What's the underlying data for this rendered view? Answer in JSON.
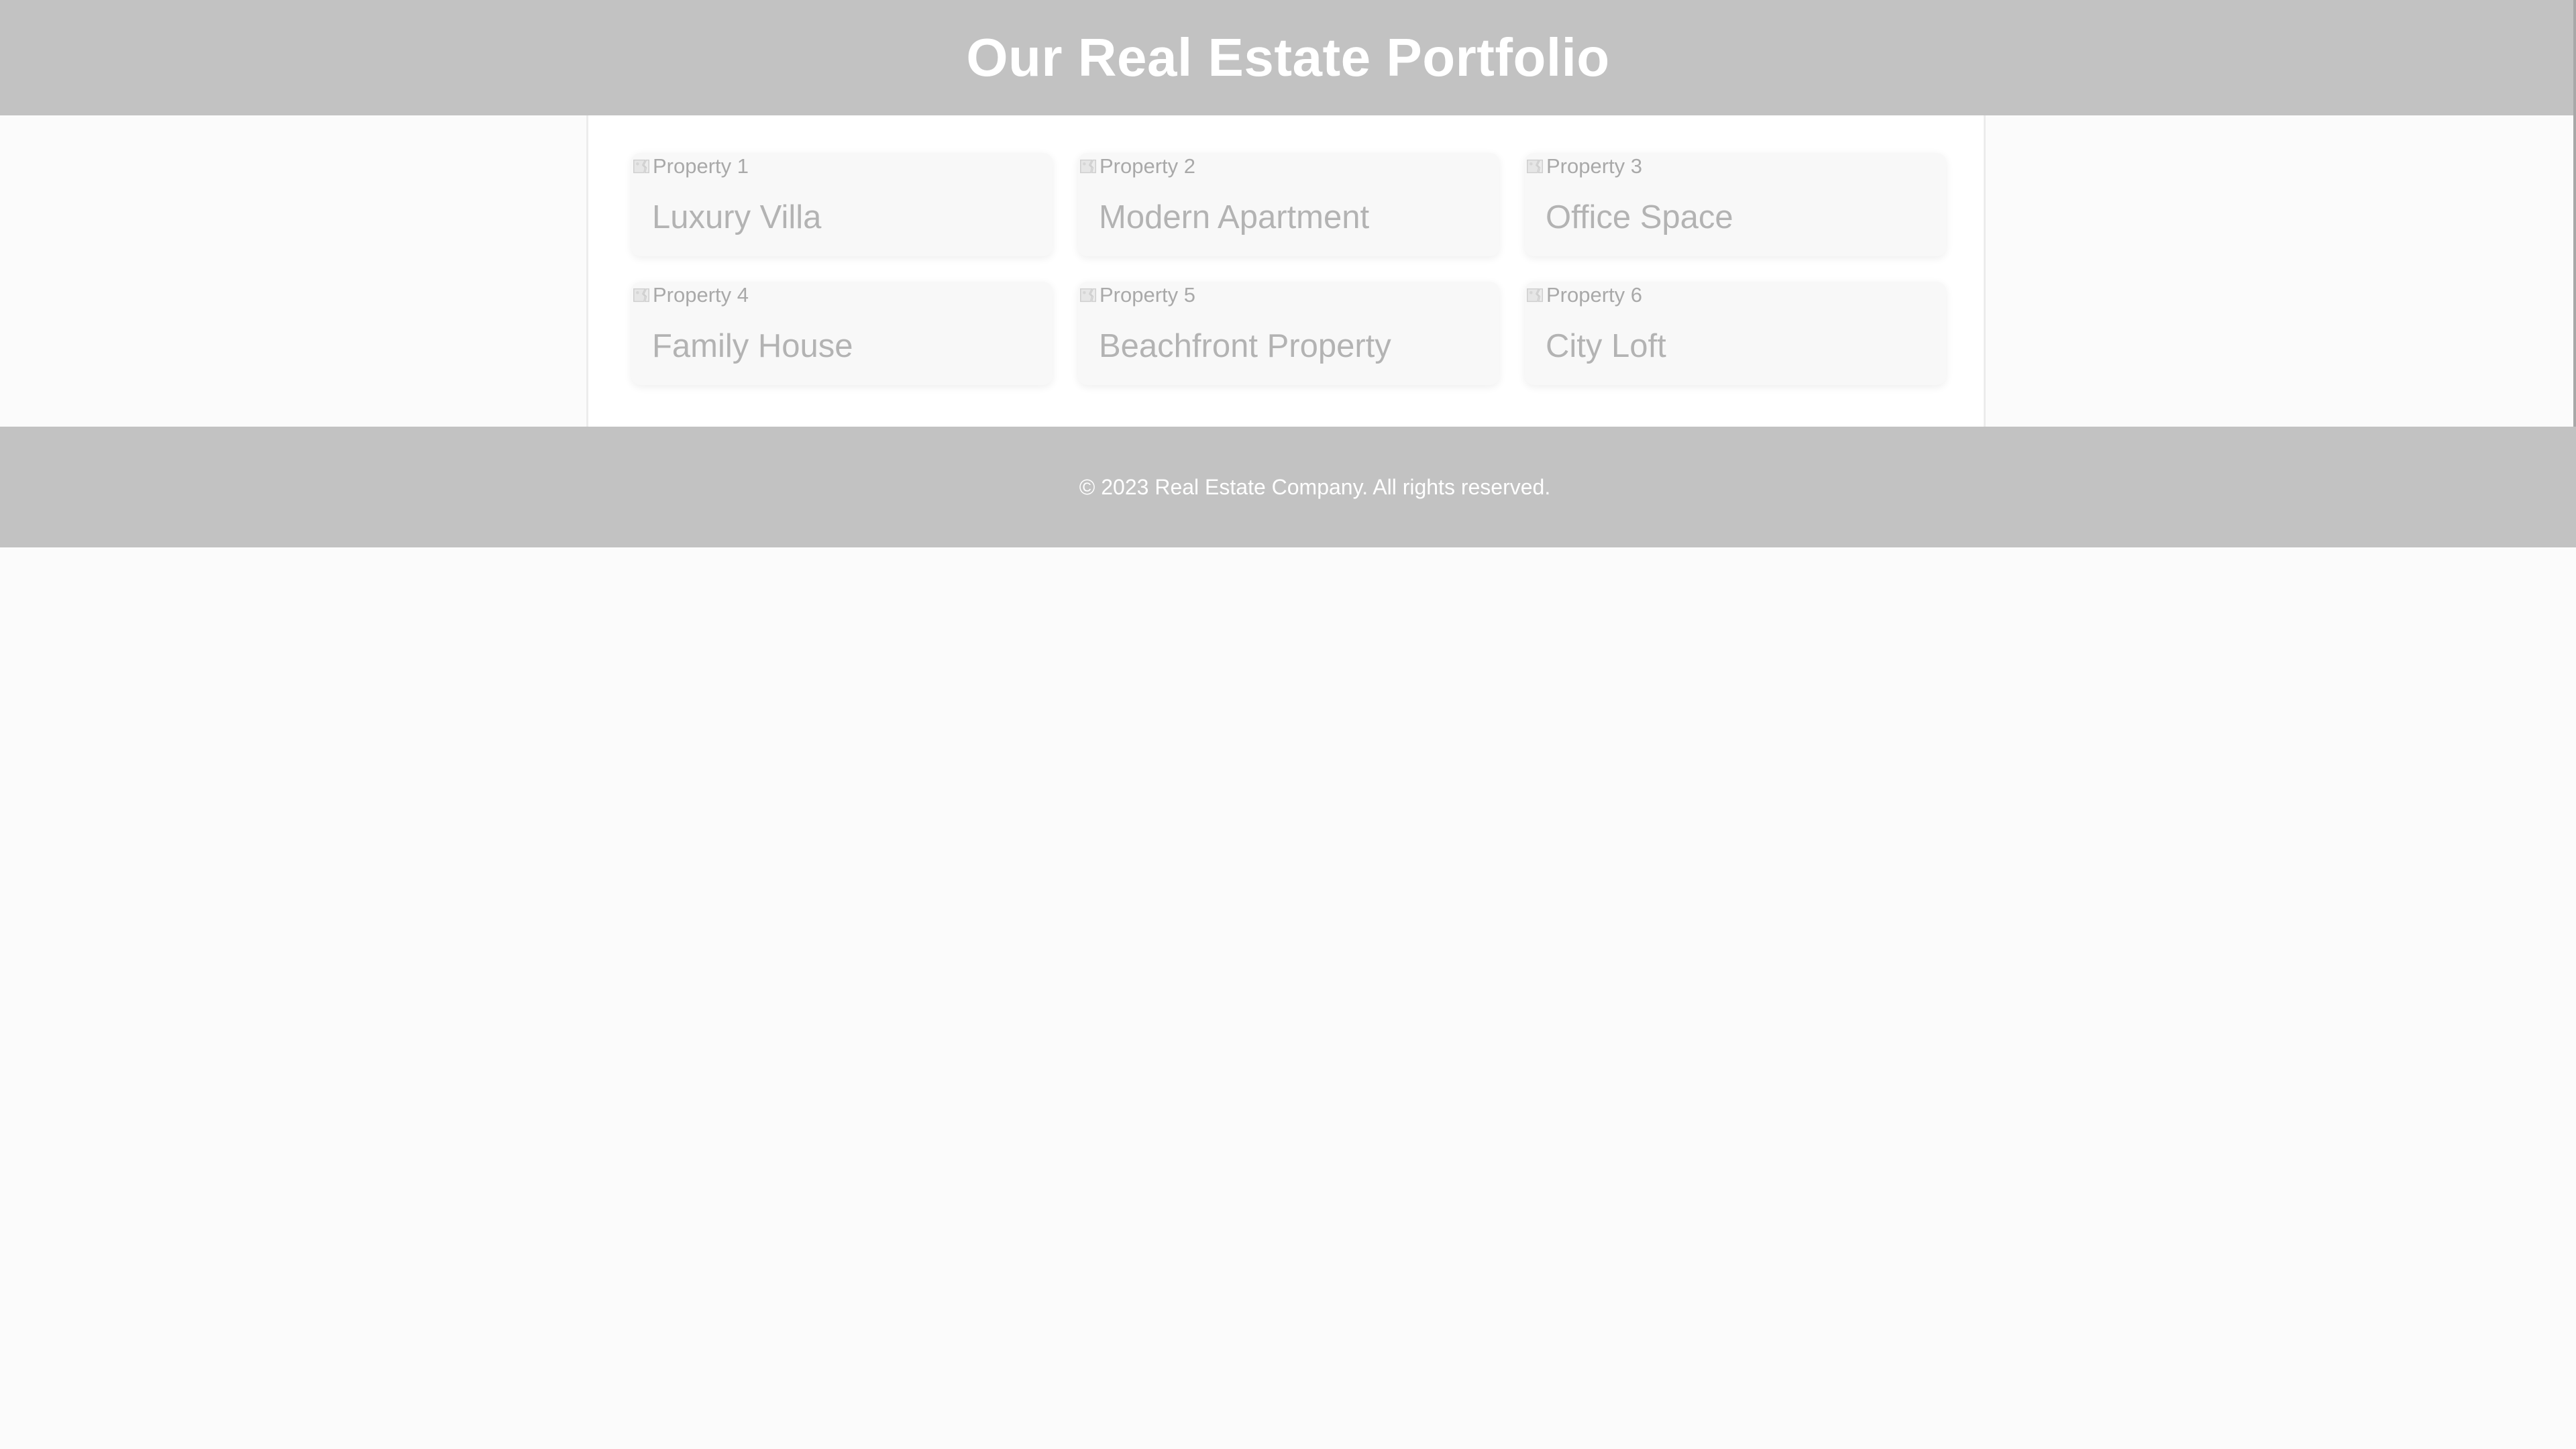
{
  "header": {
    "title": "Our Real Estate Portfolio"
  },
  "properties": [
    {
      "image_alt": "Property 1",
      "title": "Luxury Villa"
    },
    {
      "image_alt": "Property 2",
      "title": "Modern Apartment"
    },
    {
      "image_alt": "Property 3",
      "title": "Office Space"
    },
    {
      "image_alt": "Property 4",
      "title": "Family House"
    },
    {
      "image_alt": "Property 5",
      "title": "Beachfront Property"
    },
    {
      "image_alt": "Property 6",
      "title": "City Loft"
    }
  ],
  "footer": {
    "copyright": "© 2023 Real Estate Company. All rights reserved."
  },
  "colors": {
    "header_bg": "#c2c2c2",
    "footer_bg": "#c2c2c2",
    "page_bg": "#fbfbfb",
    "card_bg": "#f8f8f8",
    "card_text": "#b3b3b3"
  },
  "icons": {
    "image_placeholder": "broken-image-icon"
  }
}
